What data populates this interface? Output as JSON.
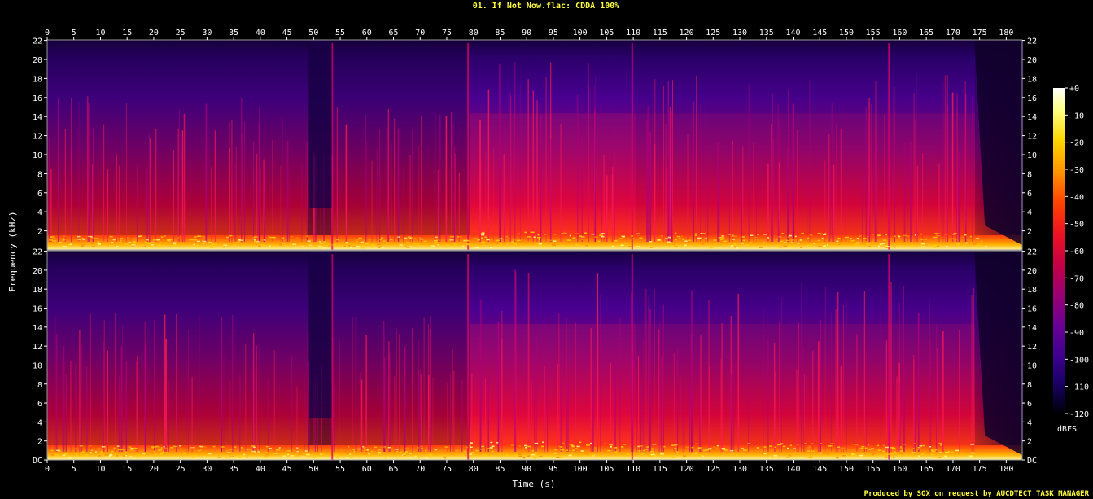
{
  "chart_data": {
    "type": "heatmap",
    "title": "01. If Not Now.flac: CDDA 100%",
    "xlabel": "Time (s)",
    "ylabel": "Frequency (kHz)",
    "footer": "Produced by SOX on request by AUCDTECT TASK MANAGER",
    "xlim": [
      0,
      183
    ],
    "ylim_khz": [
      0,
      22.05
    ],
    "x_ticks": [
      0,
      5,
      10,
      15,
      20,
      25,
      30,
      35,
      40,
      45,
      50,
      55,
      60,
      65,
      70,
      75,
      80,
      85,
      90,
      95,
      100,
      105,
      110,
      115,
      120,
      125,
      130,
      135,
      140,
      145,
      150,
      155,
      160,
      165,
      170,
      175,
      180
    ],
    "y_ticks": [
      "DC",
      "2",
      "4",
      "6",
      "8",
      "10",
      "12",
      "14",
      "16",
      "18",
      "20",
      "22"
    ],
    "channels": [
      "left",
      "right"
    ],
    "colorbar": {
      "label": "dBFS",
      "ticks": [
        "+0",
        "-10",
        "-20",
        "-30",
        "-40",
        "-50",
        "-60",
        "-70",
        "-80",
        "-90",
        "-100",
        "-110",
        "-120"
      ],
      "range": [
        0,
        -120
      ],
      "colors": [
        "#ffffff",
        "#ffff80",
        "#ffd700",
        "#ff9900",
        "#ff4400",
        "#ee1122",
        "#cc0044",
        "#a00070",
        "#700090",
        "#48009a",
        "#22007a",
        "#0a0040",
        "#000000"
      ]
    },
    "segments": [
      {
        "t_start": 0,
        "t_end": 49,
        "level": "energetic, full band"
      },
      {
        "t_start": 49,
        "t_end": 53.5,
        "level": "quiet, low band only"
      },
      {
        "t_start": 53.5,
        "t_end": 79,
        "level": "moderate"
      },
      {
        "t_start": 79,
        "t_end": 110,
        "level": "loud, dense"
      },
      {
        "t_start": 110,
        "t_end": 174,
        "level": "loud, full band"
      },
      {
        "t_start": 174,
        "t_end": 183,
        "level": "fade out"
      }
    ],
    "accent_colors": {
      "title": "#ffff40",
      "axis": "#ffffff",
      "plot_border": "#9a9a9a"
    }
  }
}
